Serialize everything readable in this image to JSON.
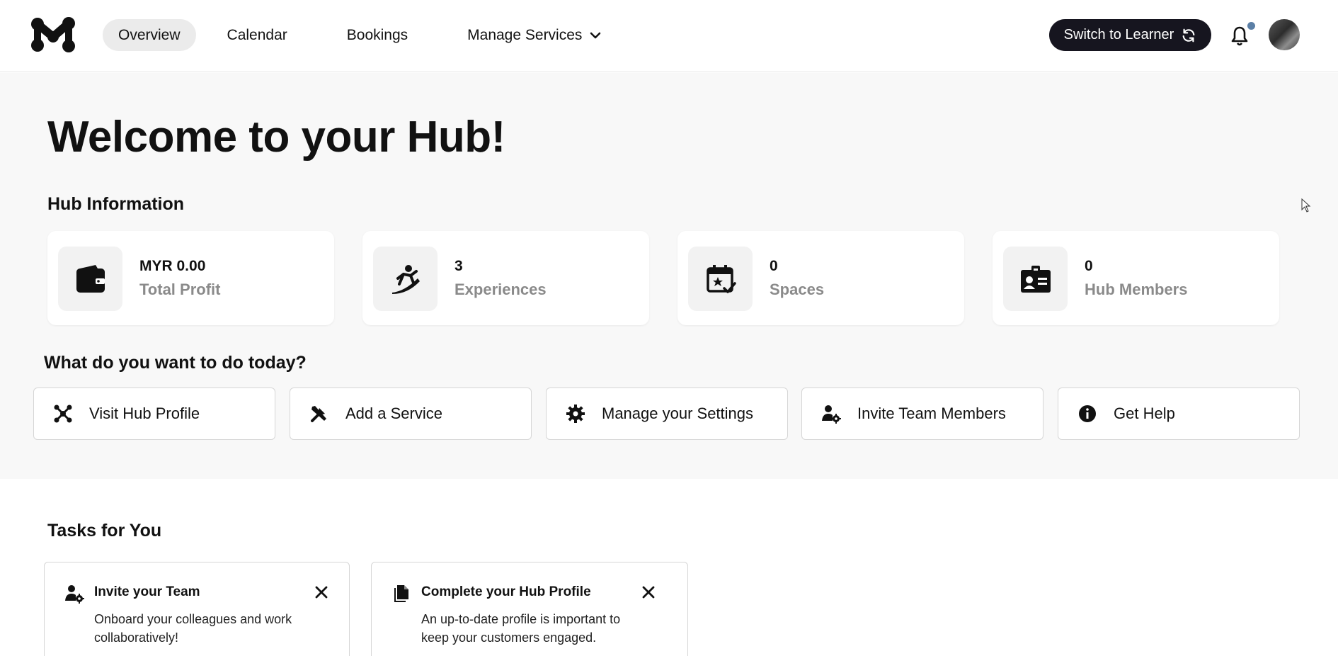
{
  "header": {
    "nav": [
      {
        "label": "Overview",
        "active": true
      },
      {
        "label": "Calendar",
        "active": false
      },
      {
        "label": "Bookings",
        "active": false
      },
      {
        "label": "Manage Services",
        "active": false
      }
    ],
    "switch_label": "Switch to Learner",
    "accent_color": "#16151f",
    "notification_dot_color": "#5b7fa6"
  },
  "main": {
    "welcome": "Welcome to your Hub!",
    "hub_info_title": "Hub Information",
    "stats": [
      {
        "value": "MYR 0.00",
        "label": "Total Profit",
        "icon": "wallet-icon"
      },
      {
        "value": "3",
        "label": "Experiences",
        "icon": "surfing-icon"
      },
      {
        "value": "0",
        "label": "Spaces",
        "icon": "calendar-star-icon"
      },
      {
        "value": "0",
        "label": "Hub Members",
        "icon": "id-card-icon"
      }
    ],
    "actions_title": "What do you want to do today?",
    "actions": [
      {
        "label": "Visit Hub Profile",
        "icon": "hub-icon"
      },
      {
        "label": "Add a Service",
        "icon": "tools-icon"
      },
      {
        "label": "Manage your Settings",
        "icon": "gear-icon"
      },
      {
        "label": "Invite Team Members",
        "icon": "user-gear-icon"
      },
      {
        "label": "Get Help",
        "icon": "info-icon"
      }
    ]
  },
  "tasks": {
    "title": "Tasks for You",
    "items": [
      {
        "title": "Invite your Team",
        "desc1": "Onboard your colleagues and work",
        "desc2": "collaboratively!",
        "icon": "user-gear-icon"
      },
      {
        "title": "Complete your Hub Profile",
        "desc1": "An up-to-date profile is important to",
        "desc2": "keep your customers engaged.",
        "icon": "documents-icon"
      }
    ]
  }
}
